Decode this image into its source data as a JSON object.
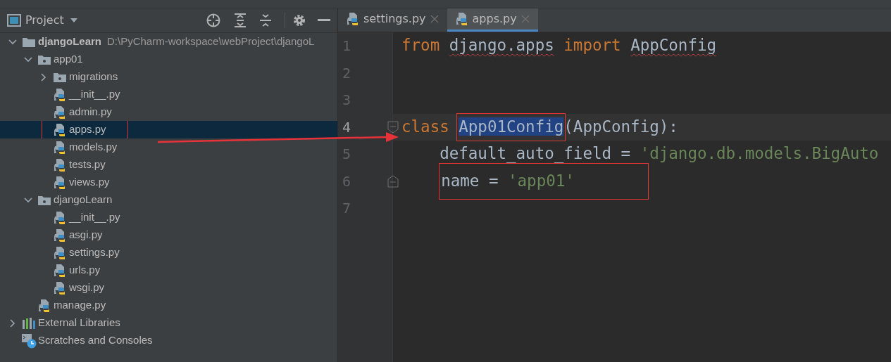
{
  "project_panel": {
    "title": "Project"
  },
  "tree": [
    {
      "label": "djangoLearn",
      "path": "D:\\PyCharm-workspace\\webProject\\djangoL",
      "kind": "folder",
      "expanded": true,
      "selected": false,
      "boxed": false,
      "children": [
        {
          "label": "app01",
          "kind": "module",
          "expanded": true,
          "selected": false,
          "boxed": false,
          "children": [
            {
              "label": "migrations",
              "kind": "module",
              "expanded": false,
              "selected": false,
              "boxed": false
            },
            {
              "label": "__init__.py",
              "kind": "python",
              "selected": false,
              "boxed": false
            },
            {
              "label": "admin.py",
              "kind": "python",
              "selected": false,
              "boxed": false
            },
            {
              "label": "apps.py",
              "kind": "python",
              "selected": true,
              "boxed": true
            },
            {
              "label": "models.py",
              "kind": "python",
              "selected": false,
              "boxed": false
            },
            {
              "label": "tests.py",
              "kind": "python",
              "selected": false,
              "boxed": false
            },
            {
              "label": "views.py",
              "kind": "python",
              "selected": false,
              "boxed": false
            }
          ]
        },
        {
          "label": "djangoLearn",
          "kind": "module",
          "expanded": true,
          "selected": false,
          "boxed": false,
          "children": [
            {
              "label": "__init__.py",
              "kind": "python",
              "selected": false,
              "boxed": false
            },
            {
              "label": "asgi.py",
              "kind": "python",
              "selected": false,
              "boxed": false
            },
            {
              "label": "settings.py",
              "kind": "python",
              "selected": false,
              "boxed": false
            },
            {
              "label": "urls.py",
              "kind": "python",
              "selected": false,
              "boxed": false
            },
            {
              "label": "wsgi.py",
              "kind": "python",
              "selected": false,
              "boxed": false
            }
          ]
        },
        {
          "label": "manage.py",
          "kind": "python",
          "selected": false,
          "boxed": false
        }
      ]
    },
    {
      "label": "External Libraries",
      "kind": "libraries",
      "expanded": false,
      "selected": false,
      "boxed": false
    },
    {
      "label": "Scratches and Consoles",
      "kind": "scratches",
      "selected": false,
      "boxed": false
    }
  ],
  "tabs": [
    {
      "label": "settings.py",
      "selected": false
    },
    {
      "label": "apps.py",
      "selected": true
    }
  ],
  "code_lines": [
    {
      "number": "1",
      "current": false,
      "tokens": [
        {
          "text": "from ",
          "kind": "keyword"
        },
        {
          "text": "django.apps",
          "kind": "plain",
          "warning": true
        },
        {
          "text": " import ",
          "kind": "keyword"
        },
        {
          "text": "AppConfig",
          "kind": "plain",
          "warning": true
        }
      ]
    },
    {
      "number": "2",
      "current": false
    },
    {
      "number": "3",
      "current": false
    },
    {
      "number": "4",
      "current": true,
      "fold_start": true,
      "tokens": [
        {
          "text": "class ",
          "kind": "keyword"
        },
        {
          "text": "App01Config",
          "kind": "plain",
          "selected": true,
          "boxed": true
        },
        {
          "text": "(AppConfig):",
          "kind": "plain"
        }
      ]
    },
    {
      "number": "5",
      "current": false,
      "tokens": [
        {
          "text": "    default_auto_field = ",
          "kind": "plain"
        },
        {
          "text": "'django.db.models.BigAuto",
          "kind": "string"
        }
      ]
    },
    {
      "number": "6",
      "current": false,
      "boxed": true,
      "fold_end": true,
      "tokens": [
        {
          "text": "    name = ",
          "kind": "plain"
        },
        {
          "text": "'app01'",
          "kind": "string"
        }
      ]
    },
    {
      "number": "7",
      "current": false
    }
  ]
}
